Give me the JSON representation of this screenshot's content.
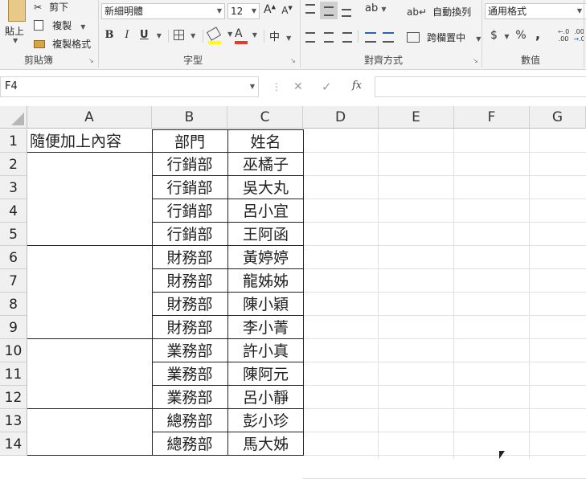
{
  "clipboard": {
    "paste_label": "貼上",
    "cut_label": "剪下",
    "copy_label": "複製",
    "format_painter_label": "複製格式",
    "group_label": "剪貼簿"
  },
  "font": {
    "font_name": "新細明體",
    "font_size": "12",
    "grow_glyph": "A",
    "shrink_glyph": "A",
    "bold": "B",
    "italic": "I",
    "underline": "U",
    "phonetic_glyph": "中",
    "group_label": "字型"
  },
  "alignment": {
    "wrap_text_label": "自動換列",
    "merge_label": "跨欄置中",
    "group_label": "對齊方式"
  },
  "number": {
    "format_value": "通用格式",
    "currency_glyph": "$",
    "percent_glyph": "%",
    "comma_glyph": ",",
    "increase_decimal": ".0",
    "increase_decimal_sub": ".00",
    "decrease_decimal": ".00",
    "decrease_decimal_sub": ".0",
    "group_label": "數值"
  },
  "formula_bar": {
    "name_box": "F4",
    "cancel_glyph": "✕",
    "enter_glyph": "✓",
    "fx_glyph": "fx",
    "formula_value": ""
  },
  "sheet": {
    "columns": [
      "A",
      "B",
      "C",
      "D",
      "E",
      "F",
      "G"
    ],
    "rows": [
      {
        "n": "1",
        "a": "隨便加上內容",
        "b": "部門",
        "c": "姓名"
      },
      {
        "n": "2",
        "a": "",
        "b": "行銷部",
        "c": "巫橘子"
      },
      {
        "n": "3",
        "a": "",
        "b": "行銷部",
        "c": "吳大丸"
      },
      {
        "n": "4",
        "a": "",
        "b": "行銷部",
        "c": "呂小宜"
      },
      {
        "n": "5",
        "a": "",
        "b": "行銷部",
        "c": "王阿函"
      },
      {
        "n": "6",
        "a": "",
        "b": "財務部",
        "c": "黃婷婷"
      },
      {
        "n": "7",
        "a": "",
        "b": "財務部",
        "c": "龍姊姊"
      },
      {
        "n": "8",
        "a": "",
        "b": "財務部",
        "c": "陳小穎"
      },
      {
        "n": "9",
        "a": "",
        "b": "財務部",
        "c": "李小菁"
      },
      {
        "n": "10",
        "a": "",
        "b": "業務部",
        "c": "許小真"
      },
      {
        "n": "11",
        "a": "",
        "b": "業務部",
        "c": "陳阿元"
      },
      {
        "n": "12",
        "a": "",
        "b": "業務部",
        "c": "呂小靜"
      },
      {
        "n": "13",
        "a": "",
        "b": "總務部",
        "c": "彭小珍"
      },
      {
        "n": "14",
        "a": "",
        "b": "總務部",
        "c": "馬大姊"
      }
    ]
  },
  "colors": {
    "ribbon_bg": "#f3f3f3",
    "highlight_yellow": "#ffff00",
    "font_red": "#e03c31",
    "header_bg": "#f0f0f0"
  }
}
